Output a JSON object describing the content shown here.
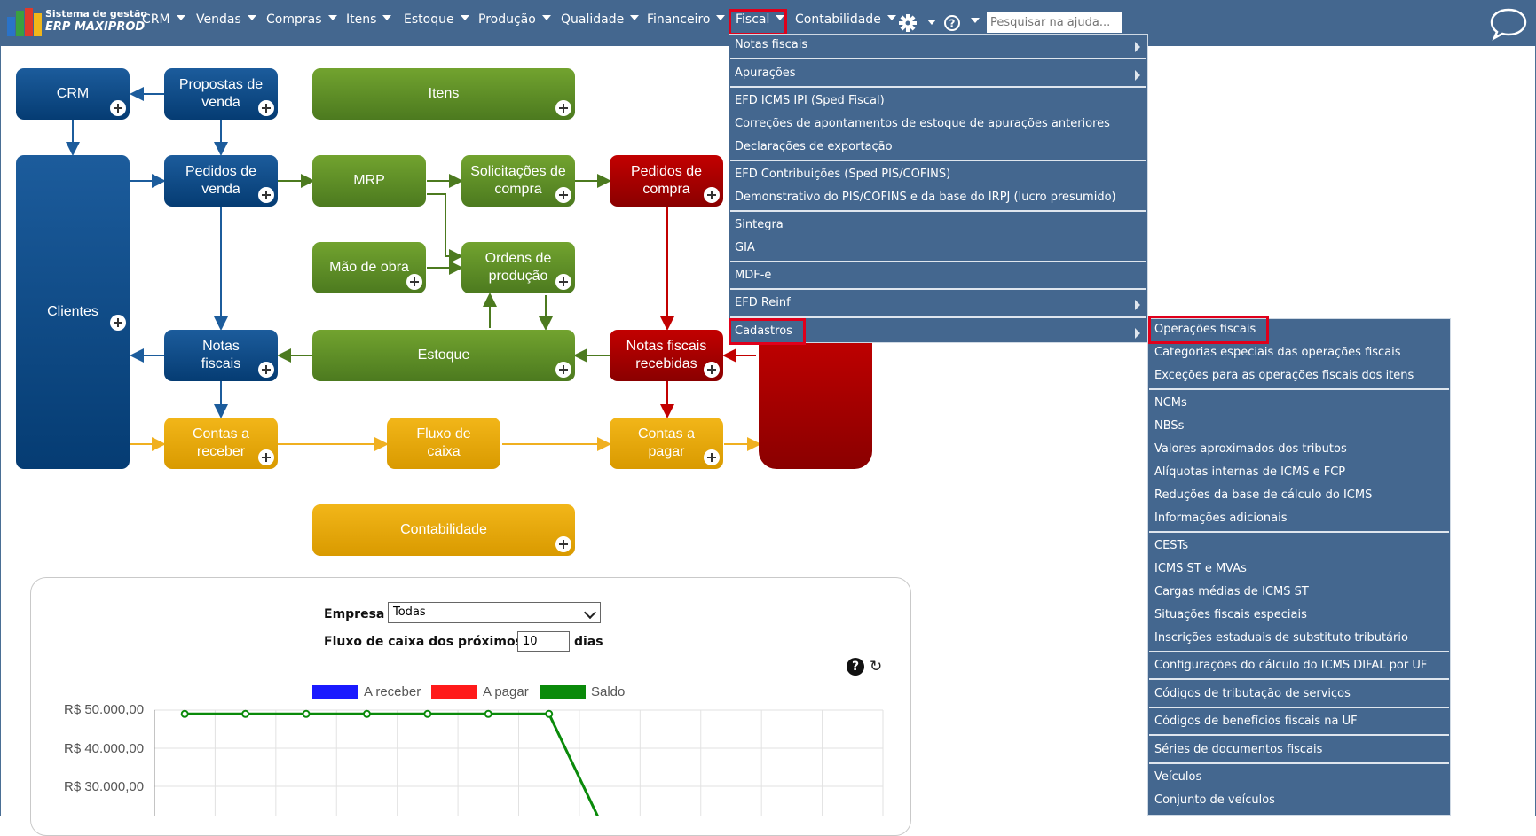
{
  "brand": {
    "line1": "Sistema de gestão",
    "line2": "ERP MAXIPROD"
  },
  "nav": [
    {
      "label": "CRM"
    },
    {
      "label": "Vendas"
    },
    {
      "label": "Compras"
    },
    {
      "label": "Itens"
    },
    {
      "label": "Estoque"
    },
    {
      "label": "Produção"
    },
    {
      "label": "Qualidade"
    },
    {
      "label": "Financeiro"
    },
    {
      "label": "Fiscal"
    },
    {
      "label": "Contabilidade"
    }
  ],
  "search": {
    "placeholder": "Pesquisar na ajuda..."
  },
  "icons": {
    "settings": "gear-icon",
    "help": "question-circle-icon",
    "chat": "speech-bubble-icon"
  },
  "fiscal_menu": [
    {
      "label": "Notas fiscais"
    },
    {
      "label": "Apurações"
    },
    {
      "label": "EFD ICMS IPI (Sped Fiscal)"
    },
    {
      "label": "Correções de apontamentos de estoque de apurações anteriores"
    },
    {
      "label": "Declarações de exportação"
    },
    {
      "label": "EFD Contribuições (Sped PIS/COFINS)"
    },
    {
      "label": "Demonstrativo do PIS/COFINS e da base do IRPJ (lucro presumido)"
    },
    {
      "label": "Sintegra"
    },
    {
      "label": "GIA"
    },
    {
      "label": "MDF-e"
    },
    {
      "label": "EFD Reinf"
    },
    {
      "label": "Cadastros"
    }
  ],
  "cadastros_menu": [
    {
      "label": "Operações fiscais"
    },
    {
      "label": "Categorias especiais das operações fiscais"
    },
    {
      "label": "Exceções para as operações fiscais dos itens"
    },
    {
      "label": "NCMs"
    },
    {
      "label": "NBSs"
    },
    {
      "label": "Valores aproximados dos tributos"
    },
    {
      "label": "Alíquotas internas de ICMS e FCP"
    },
    {
      "label": "Reduções da base de cálculo do ICMS"
    },
    {
      "label": "Informações adicionais"
    },
    {
      "label": "CESTs"
    },
    {
      "label": "ICMS ST e MVAs"
    },
    {
      "label": "Cargas médias de ICMS ST"
    },
    {
      "label": "Situações fiscais especiais"
    },
    {
      "label": "Inscrições estaduais de substituto tributário"
    },
    {
      "label": "Configurações do cálculo do ICMS DIFAL por UF"
    },
    {
      "label": "Códigos de tributação de serviços"
    },
    {
      "label": "Códigos de benefícios fiscais na UF"
    },
    {
      "label": "Séries de documentos fiscais"
    },
    {
      "label": "Veículos"
    },
    {
      "label": "Conjunto de veículos"
    }
  ],
  "flow": {
    "crm": "CRM",
    "propostas": [
      "Propostas de",
      "venda"
    ],
    "itens": "Itens",
    "clientes": "Clientes",
    "pedidos_venda": [
      "Pedidos de",
      "venda"
    ],
    "mrp": "MRP",
    "solicitacoes": [
      "Solicitações de",
      "compra"
    ],
    "pedidos_compra": [
      "Pedidos de",
      "compra"
    ],
    "mao_obra": "Mão de obra",
    "ordens": [
      "Ordens de",
      "produção"
    ],
    "notas_fiscais": [
      "Notas",
      "fiscais"
    ],
    "estoque": "Estoque",
    "notas_recebidas": [
      "Notas fiscais",
      "recebidas"
    ],
    "contas_receber": [
      "Contas a",
      "receber"
    ],
    "fluxo_caixa": [
      "Fluxo de",
      "caixa"
    ],
    "contas_pagar": [
      "Contas a",
      "pagar"
    ],
    "contabilidade": "Contabilidade",
    "colors": {
      "blue": "#0a4a8a",
      "green": "#5d8e26",
      "red": "#a80000",
      "yellow": "#e5a800"
    }
  },
  "cashflow": {
    "empresa_label": "Empresa",
    "empresa_value": "Todas",
    "fluxo_label": "Fluxo de caixa dos próximos",
    "dias_value": "10",
    "dias_label": "dias"
  },
  "chart_data": {
    "type": "line",
    "series": [
      {
        "name": "A receber",
        "color": "#1a1aff",
        "values": []
      },
      {
        "name": "A pagar",
        "color": "#ff1a1a",
        "values": []
      },
      {
        "name": "Saldo",
        "color": "#0a8a0a",
        "values": [
          49000,
          49000,
          49000,
          49000,
          49000,
          49000,
          49000
        ]
      }
    ],
    "y_ticks": [
      "R$ 50.000,00",
      "R$ 40.000,00",
      "R$ 30.000,00"
    ],
    "grid": true,
    "legend": "top"
  }
}
